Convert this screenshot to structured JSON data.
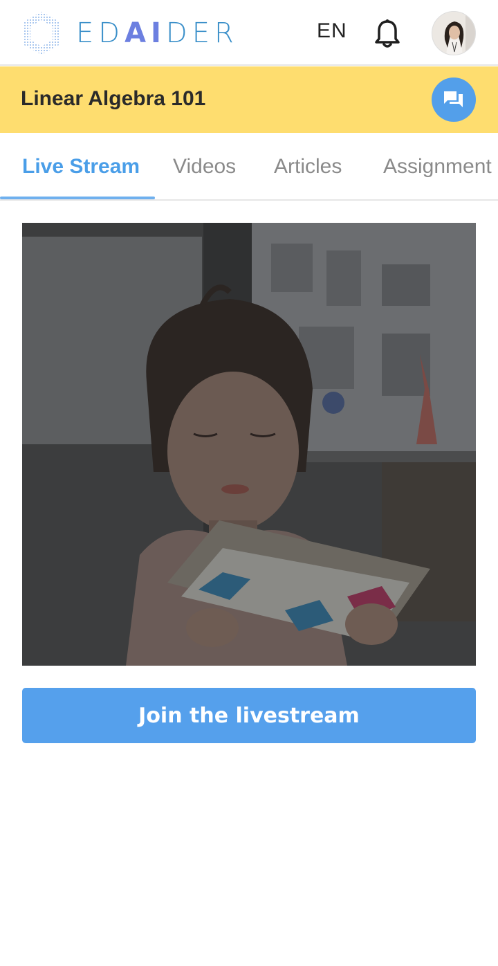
{
  "header": {
    "logo_text_before": "ED",
    "logo_text_ai": "AI",
    "logo_text_after": "DER",
    "language": "EN",
    "icons": {
      "logo": "hexagon-logo-icon",
      "notifications": "bell-icon",
      "avatar": "user-avatar"
    }
  },
  "course": {
    "title": "Linear Algebra 101",
    "chat_icon": "chat-bubbles-icon"
  },
  "tabs": [
    {
      "label": "Live Stream",
      "active": true
    },
    {
      "label": "Videos",
      "active": false
    },
    {
      "label": "Articles",
      "active": false
    },
    {
      "label": "Assignment",
      "active": false
    }
  ],
  "main": {
    "join_label": "Join the livestream"
  },
  "colors": {
    "accent": "#55a0ec",
    "course_bar": "#fedd6f",
    "tab_active": "#4a9ee8"
  }
}
